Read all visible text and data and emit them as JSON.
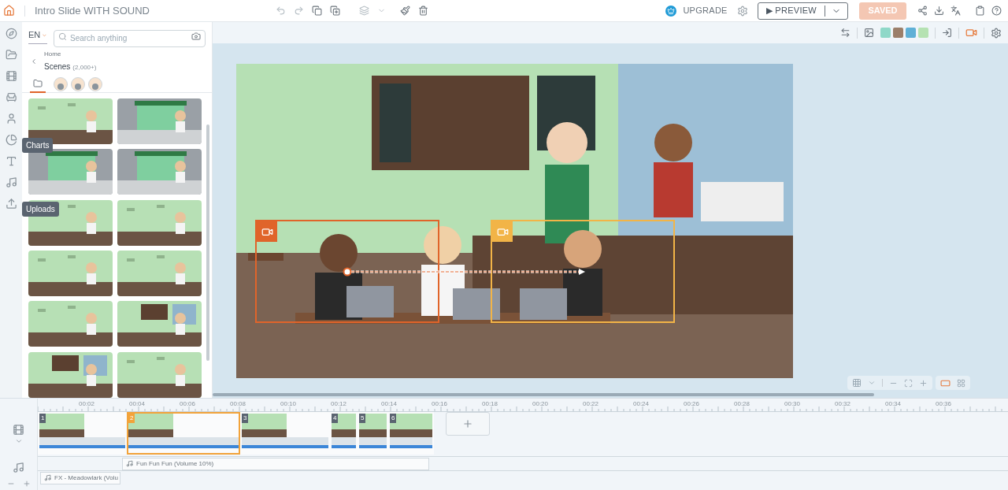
{
  "topbar": {
    "title": "Intro Slide WITH SOUND",
    "upgrade": "UPGRADE",
    "preview_icon": "▶",
    "preview": "PREVIEW",
    "saved": "SAVED"
  },
  "toolbar": {
    "swatches": [
      {
        "color": "#8fd8c8"
      },
      {
        "color": "#9b7f6a"
      },
      {
        "color": "#5fb0d6"
      },
      {
        "color": "#b5e2b2"
      }
    ]
  },
  "rail": {
    "items": [
      {
        "kind": "compass"
      },
      {
        "kind": "folder"
      },
      {
        "kind": "scenes"
      },
      {
        "kind": "props"
      },
      {
        "kind": "character"
      },
      {
        "kind": "chart",
        "tooltip": "Charts"
      },
      {
        "kind": "text"
      },
      {
        "kind": "music"
      },
      {
        "kind": "upload",
        "tooltip": "Uploads"
      }
    ]
  },
  "panel": {
    "language": "EN",
    "search": {
      "placeholder": "Search anything"
    },
    "breadcrumb": "Home",
    "title": "Scenes",
    "count": "(2,000+)",
    "tabs": [
      {
        "kind": "folder",
        "selected": true
      },
      {
        "kind": "avatar",
        "selected": false
      },
      {
        "kind": "avatar",
        "selected": false
      },
      {
        "kind": "avatar",
        "selected": false
      }
    ],
    "thumbnails": [
      {
        "kind": "cafe"
      },
      {
        "kind": "street"
      },
      {
        "kind": "street"
      },
      {
        "kind": "street"
      },
      {
        "kind": "cafe"
      },
      {
        "kind": "cafe"
      },
      {
        "kind": "cafe"
      },
      {
        "kind": "cafe"
      },
      {
        "kind": "cafe"
      },
      {
        "kind": "interior"
      },
      {
        "kind": "interior"
      },
      {
        "kind": "cafe"
      }
    ]
  },
  "stage": {
    "frames": [
      {
        "color": "#e0642a"
      },
      {
        "color": "#f2b447"
      }
    ]
  },
  "timeline": {
    "ruler": [
      "00:02",
      "00:04",
      "00:06",
      "00:08",
      "00:10",
      "00:12",
      "00:14",
      "00:16",
      "00:18",
      "00:20",
      "00:22",
      "00:24",
      "00:26",
      "00:28",
      "00:30",
      "00:32",
      "00:34",
      "00:36"
    ],
    "scenes": [
      {
        "number": "1",
        "selected": false
      },
      {
        "number": "2",
        "selected": true
      },
      {
        "number": "3",
        "selected": false
      },
      {
        "number": "4",
        "selected": false
      },
      {
        "number": "5",
        "selected": false
      },
      {
        "number": "6",
        "selected": false
      }
    ],
    "audio": [
      {
        "label": "Fun Fun Fun (Volume 10%)"
      },
      {
        "label": "FX - Meadowlark (Volu"
      }
    ]
  }
}
